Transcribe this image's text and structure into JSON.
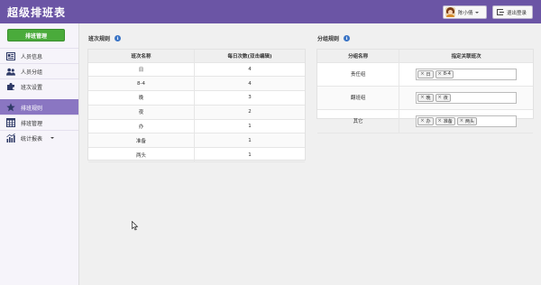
{
  "header": {
    "title": "超级排班表",
    "user_name": "陈小倩",
    "logout_label": "退出登录"
  },
  "sidebar": {
    "header_button": "排班管理",
    "items": [
      {
        "label": "人员信息",
        "icon": "id-card-icon"
      },
      {
        "label": "人员分组",
        "icon": "users-icon"
      },
      {
        "label": "班次设置",
        "icon": "puzzle-icon"
      },
      {
        "label": "排班规则",
        "icon": "star-icon",
        "active": true
      },
      {
        "label": "排班管理",
        "icon": "calendar-grid-icon"
      },
      {
        "label": "统计报表",
        "icon": "bar-chart-icon",
        "has_submenu": true
      }
    ]
  },
  "shift_rules": {
    "title": "班次规则",
    "columns": [
      "班次名称",
      "每日次数(双击编辑)"
    ],
    "rows": [
      [
        "日",
        "4"
      ],
      [
        "8-4",
        "4"
      ],
      [
        "晚",
        "3"
      ],
      [
        "夜",
        "2"
      ],
      [
        "办",
        "1"
      ],
      [
        "准备",
        "1"
      ],
      [
        "两头",
        "1"
      ]
    ]
  },
  "group_rules": {
    "title": "分组规则",
    "columns": [
      "分组名称",
      "指定关联班次"
    ],
    "rows": [
      {
        "name": "责任组",
        "tags": [
          "日",
          "8-4"
        ]
      },
      {
        "name": "翻班组",
        "tags": [
          "晚",
          "夜"
        ]
      },
      {
        "name": "其它",
        "tags": [
          "办",
          "准备",
          "两头"
        ]
      }
    ]
  },
  "colors": {
    "topbar": "#6b55a5",
    "sidebar_active": "#8a76c2",
    "primary_button": "#4aab3b",
    "info_icon": "#3a74c5"
  }
}
